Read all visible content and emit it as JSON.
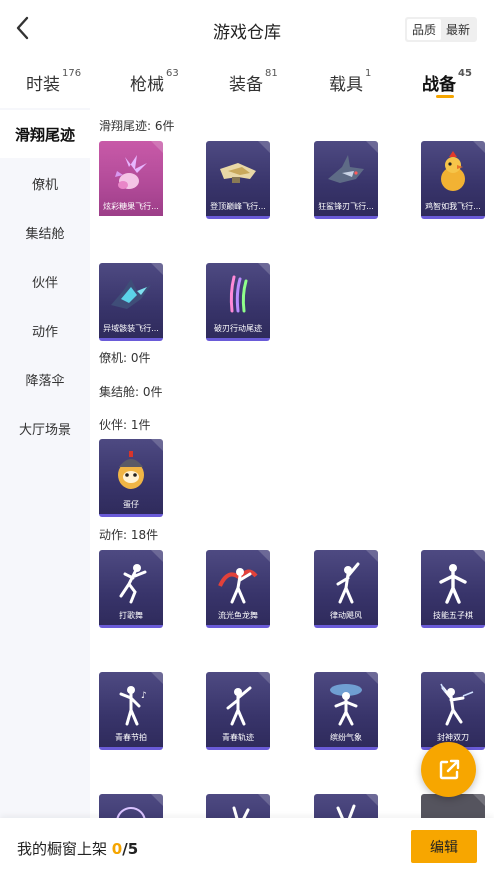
{
  "header": {
    "title": "游戏仓库",
    "sort": [
      "品质",
      "最新"
    ]
  },
  "tabs": [
    {
      "label": "时装",
      "count": "176"
    },
    {
      "label": "枪械",
      "count": "63"
    },
    {
      "label": "装备",
      "count": "81"
    },
    {
      "label": "载具",
      "count": "1"
    },
    {
      "label": "战备",
      "count": "45"
    }
  ],
  "sidebar": [
    "滑翔尾迹",
    "僚机",
    "集结舱",
    "伙伴",
    "动作",
    "降落伞",
    "大厅场景"
  ],
  "sections": {
    "trail": {
      "title": "滑翔尾迹: 6件",
      "items": [
        "炫彩糖果飞行...",
        "登顶巅峰飞行...",
        "狂鲨锋刃飞行...",
        "鸡智如我飞行...",
        "异域骸装飞行...",
        "破刃行动尾迹"
      ]
    },
    "wingman": {
      "title": "僚机: 0件"
    },
    "pod": {
      "title": "集结舱: 0件"
    },
    "partner": {
      "title": "伙伴: 1件",
      "items": [
        "蛋仔"
      ]
    },
    "emote": {
      "title": "动作: 18件",
      "items": [
        "打歌舞",
        "流光鱼龙舞",
        "律动飓风",
        "技能五子棋",
        "青春节拍",
        "青春轨迹",
        "缤纷气象",
        "封神双刀"
      ]
    }
  },
  "bottom": {
    "label": "我的橱窗上架",
    "current": "0",
    "total": "/5",
    "edit": "编辑"
  },
  "colors": {
    "accent": "#f7a600",
    "card_purple": "#3a366c",
    "card_pink": "#b14a98"
  }
}
